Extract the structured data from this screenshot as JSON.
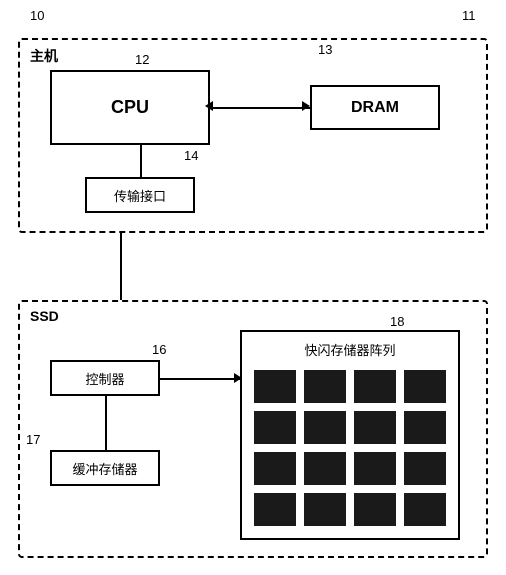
{
  "labels": {
    "ref10": "10",
    "ref11": "11",
    "ref12": "12",
    "ref13": "13",
    "ref14": "14",
    "ref16": "16",
    "ref17": "17",
    "ref18": "18",
    "host": "主机",
    "cpu": "CPU",
    "dram": "DRAM",
    "transfer": "传输接口",
    "ssd": "SSD",
    "controller": "控制器",
    "buffer": "缓冲存储器",
    "flash": "快闪存储器阵列"
  }
}
